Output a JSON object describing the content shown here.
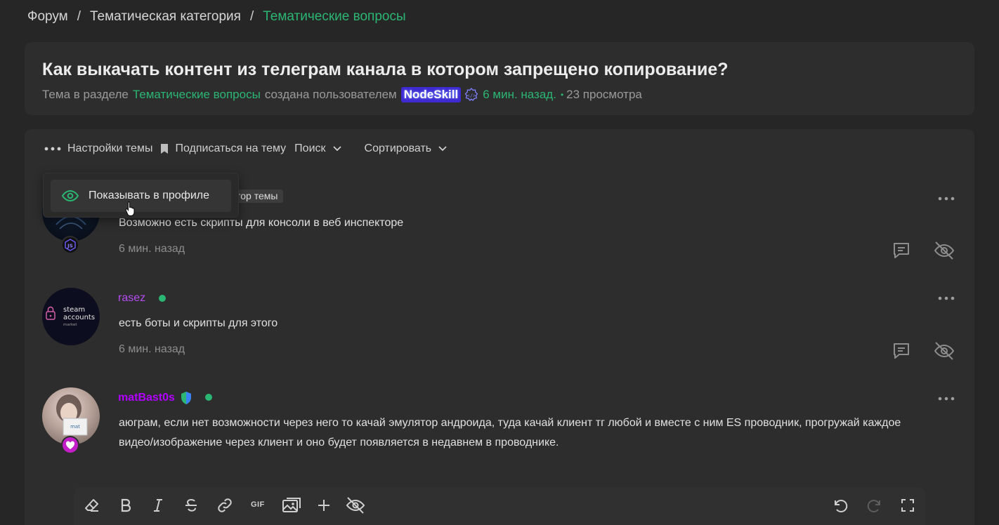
{
  "breadcrumb": {
    "items": [
      "Форум",
      "Тематическая категория",
      "Тематические вопросы"
    ],
    "separator": "/"
  },
  "topic": {
    "title": "Как выкачать контент из телеграм канала в котором запрещено копирование?",
    "meta_prefix": "Тема в разделе",
    "section": "Тематические вопросы",
    "meta_created_by": "создана пользователем",
    "author": "NodeSkill",
    "time_ago": "6 мин. назад.",
    "views": "23 просмотра"
  },
  "toolbar": {
    "settings_label": "Настройки темы",
    "subscribe_label": "Подписаться на тему",
    "search_label": "Поиск",
    "sort_label": "Сортировать"
  },
  "dropdown": {
    "show_in_profile": "Показывать в профиле"
  },
  "posts": [
    {
      "author": "",
      "role": "тор темы",
      "text": "Возможно есть скрипты для консоли в веб инспекторе",
      "time": "6 мин. назад"
    },
    {
      "author": "rasez",
      "avatar_text": [
        "steam",
        "accounts",
        "market"
      ],
      "text": "есть боты и скрипты для этого",
      "time": "6 мин. назад"
    },
    {
      "author": "matBast0s",
      "text_line1": "аюграм, если нет возможности через него то качай эмулятор андроида, туда качай клиент тг любой и вместе с ним ES проводник, прогружай каждое",
      "text_line2": "видео/изображение через клиент и оно будет появляется в недавнем в проводнике."
    }
  ],
  "editor": {
    "gif_label": "GIF"
  },
  "colors": {
    "accent": "#2bb673",
    "background": "#262626",
    "card": "#2d2d2d",
    "author_highlight": "#3f2ad1",
    "username_purple": "#b44cf0"
  }
}
